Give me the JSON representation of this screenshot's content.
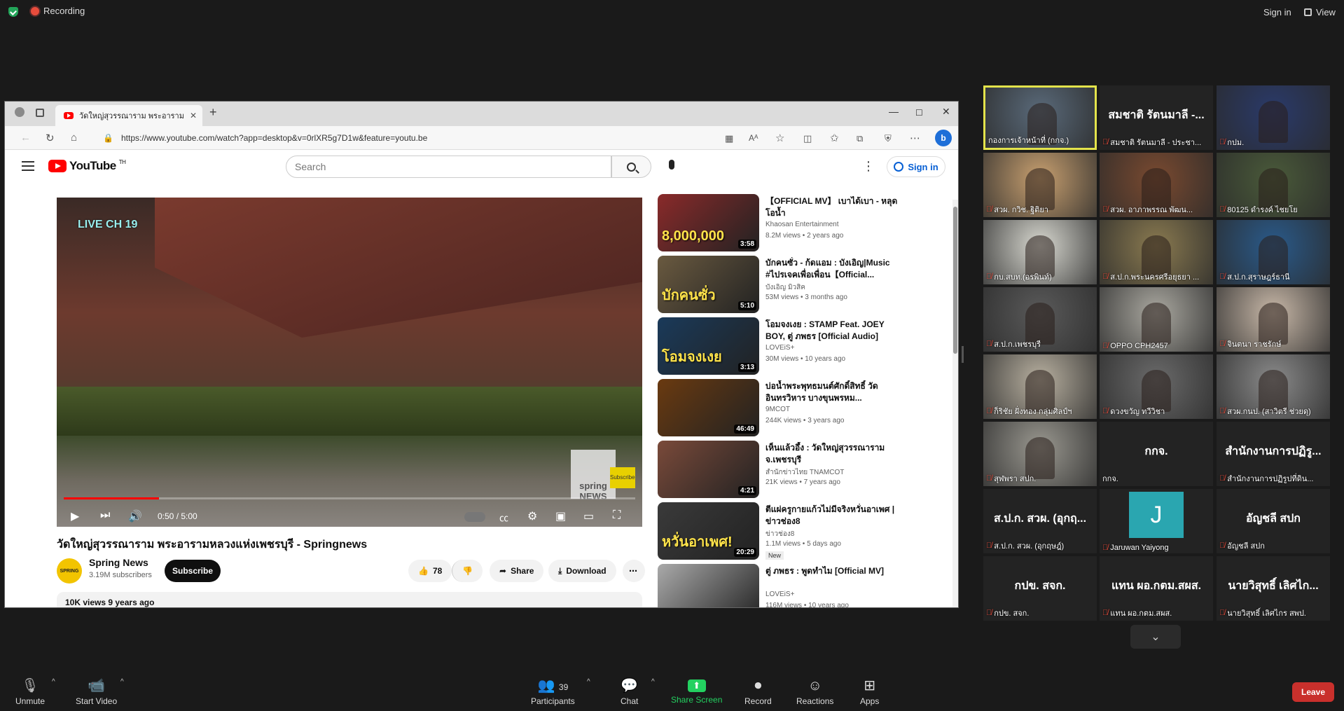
{
  "zoom_top": {
    "recording": "Recording",
    "sign_in": "Sign in",
    "view": "View"
  },
  "browser": {
    "tab_title": "วัดใหญ่สุวรรณาราม พระอารามหลวงแห่งเพชรบุรี",
    "url": "https://www.youtube.com/watch?app=desktop&v=0rlXR5g7D1w&feature=youtu.be"
  },
  "youtube": {
    "logo": "YouTube",
    "logo_tm": "TH",
    "search_placeholder": "Search",
    "sign_in": "Sign in",
    "player": {
      "live_badge": "LIVE CH 19",
      "time": "0:50 / 5:00",
      "progress": 0.167,
      "watermark": "spring NEWS",
      "subscribe_wm": "Subscribe"
    },
    "video_title": "วัดใหญ่สุวรรณาราม พระอารามหลวงแห่งเพชรบุรี - Springnews",
    "channel": {
      "avatar": "SPRING",
      "name": "Spring News",
      "subs": "3.19M subscribers",
      "subscribe": "Subscribe"
    },
    "actions": {
      "likes": "78",
      "share": "Share",
      "download": "Download"
    },
    "description": "10K views  9 years ago",
    "related": [
      {
        "title": "【OFFICIAL MV】 เบาได้เบา - หลุด โอน้ำ",
        "channel": "Khaosan Entertainment",
        "meta": "8.2M views • 2 years ago",
        "duration": "3:58",
        "color": "#8a2a2a",
        "overlay": "8,000,000"
      },
      {
        "title": "บักคนซั่ว - ก้ดแอม : บังเอิญ|Music #ไปรเจคเพื่อเพื่อน【Official...",
        "channel": "บังเอิญ มิวสิค",
        "meta": "53M views • 3 months ago",
        "duration": "5:10",
        "color": "#6a5a40",
        "overlay": "บักคนซั่ว"
      },
      {
        "title": "โอมจงเงย : STAMP Feat. JOEY BOY, ตู่ ภพธร [Official Audio]",
        "channel": "LOVEiS+",
        "meta": "30M views • 10 years ago",
        "duration": "3:13",
        "color": "#1a3a5a",
        "overlay": "โอมจงเงย"
      },
      {
        "title": "บ่อน้ำพระพุทธมนต์ศักดิ์สิทธิ์ วัดอินทรวิหาร บางขุนพรหม...",
        "channel": "9MCOT",
        "meta": "244K views • 3 years ago",
        "duration": "46:49",
        "color": "#6a3a10",
        "overlay": ""
      },
      {
        "title": "เห็นแล้วอึ้ง : วัดใหญ่สุวรรณาราม จ.เพชรบุรี",
        "channel": "สำนักข่าวไทย TNAMCOT",
        "meta": "21K views • 7 years ago",
        "duration": "4:21",
        "color": "#7a4a3a",
        "overlay": ""
      },
      {
        "title": "ตีแผ่ครูกายแก้วไม่มีจริงหวั่นอาเพศ | ข่าวช่อง8",
        "channel": "ข่าวช่อง8",
        "meta": "1.1M views • 5 days ago",
        "badge": "New",
        "duration": "20:29",
        "color": "#3a3a3a",
        "overlay": "หวั่นอาเพศ!"
      },
      {
        "title": "ตู่ ภพธร : พูดทำไม [Official MV]",
        "channel": "LOVEiS+",
        "meta": "116M views • 10 years ago",
        "duration": "",
        "color": "#aaa",
        "overlay": ""
      }
    ]
  },
  "participants": [
    {
      "label": "กองการเจ้าหน้าที่ (กกจ.)",
      "big": "",
      "video": "#5a6a7a",
      "active": true,
      "muted": false
    },
    {
      "label": "สมชาติ รัตนมาลี - ประชา...",
      "big": "สมชาติ รัตนมาลี -...",
      "video": "",
      "muted": true
    },
    {
      "label": "กปม.",
      "big": "",
      "video": "#2a3a6a",
      "muted": true
    },
    {
      "label": "สวผ. กวิช. ฐิติยา",
      "big": "",
      "video": "#c8a070",
      "muted": true
    },
    {
      "label": "สวผ. อาภาพรรณ พัฒน...",
      "big": "",
      "video": "#7a4a30",
      "muted": true
    },
    {
      "label": "80125 ดำรงค์ ไชยโย",
      "big": "",
      "video": "#4a5a3a",
      "muted": true
    },
    {
      "label": "กบ.สบท.(อรพินท์)",
      "big": "",
      "video": "#d8d8d0",
      "muted": true
    },
    {
      "label": "ส.ป.ก.พระนครศรีอยุธยา ...",
      "big": "",
      "video": "#8a7a50",
      "muted": true
    },
    {
      "label": "ส.ป.ก.สุราษฎร์ธานี",
      "big": "",
      "video": "#2a5a8a",
      "muted": true
    },
    {
      "label": "ส.ป.ก.เพชรบุรี",
      "big": "",
      "video": "#5a5a5a",
      "muted": true
    },
    {
      "label": "OPPO CPH2457",
      "big": "",
      "video": "#aaa8a0",
      "muted": true
    },
    {
      "label": "จินตนา ราชรักษ์",
      "big": "",
      "video": "#c8b8a8",
      "muted": true
    },
    {
      "label": "ก็ริชัย ฝั่งทอง กลุ่มศิลป์ฯ",
      "big": "",
      "video": "#b8b0a0",
      "muted": true
    },
    {
      "label": "ดวงขวัญ ทวีวิชา",
      "big": "",
      "video": "#6a6a6a",
      "muted": true
    },
    {
      "label": "สวผ.กนป. (สาวิตรี ช่วยดุ)",
      "big": "",
      "video": "#8a8a8a",
      "muted": true
    },
    {
      "label": "สุฬพรา สปก.",
      "big": "",
      "video": "#9a9890",
      "muted": true
    },
    {
      "label": "กกจ.",
      "big": "กกจ.",
      "video": "",
      "muted": false
    },
    {
      "label": "สำนักงานการปฏิรูปที่ดิน...",
      "big": "สำนักงานการปฏิรู...",
      "video": "",
      "muted": true
    },
    {
      "label": "ส.ป.ก. สวผ. (อุกฤษฎ์)",
      "big": "ส.ป.ก. สวผ. (อุกฤ...",
      "video": "",
      "muted": true
    },
    {
      "label": "Jaruwan Yaiyong",
      "big": "",
      "initial": "J",
      "video": "",
      "muted": true
    },
    {
      "label": "อัญชลี สปก",
      "big": "อัญชลี สปก",
      "video": "",
      "muted": true
    },
    {
      "label": "กปข. สจก.",
      "big": "กปข. สจก.",
      "video": "",
      "muted": true
    },
    {
      "label": "แทน ผอ.กตม.สผส.",
      "big": "แทน ผอ.กตม.สผส.",
      "video": "",
      "muted": true
    },
    {
      "label": "นายวิสุทธิ์ เลิศไกร สพป.",
      "big": "นายวิสุทธิ์ เลิศไก...",
      "video": "",
      "muted": true
    }
  ],
  "toolbar": {
    "unmute": "Unmute",
    "start_video": "Start Video",
    "participants": "Participants",
    "participants_count": "39",
    "chat": "Chat",
    "share_screen": "Share Screen",
    "record": "Record",
    "reactions": "Reactions",
    "apps": "Apps",
    "leave": "Leave"
  },
  "colors": {
    "share_green": "#23d160",
    "leave_red": "#c9302c",
    "yt_red": "#ff0000",
    "active_border": "#e3e34b"
  }
}
